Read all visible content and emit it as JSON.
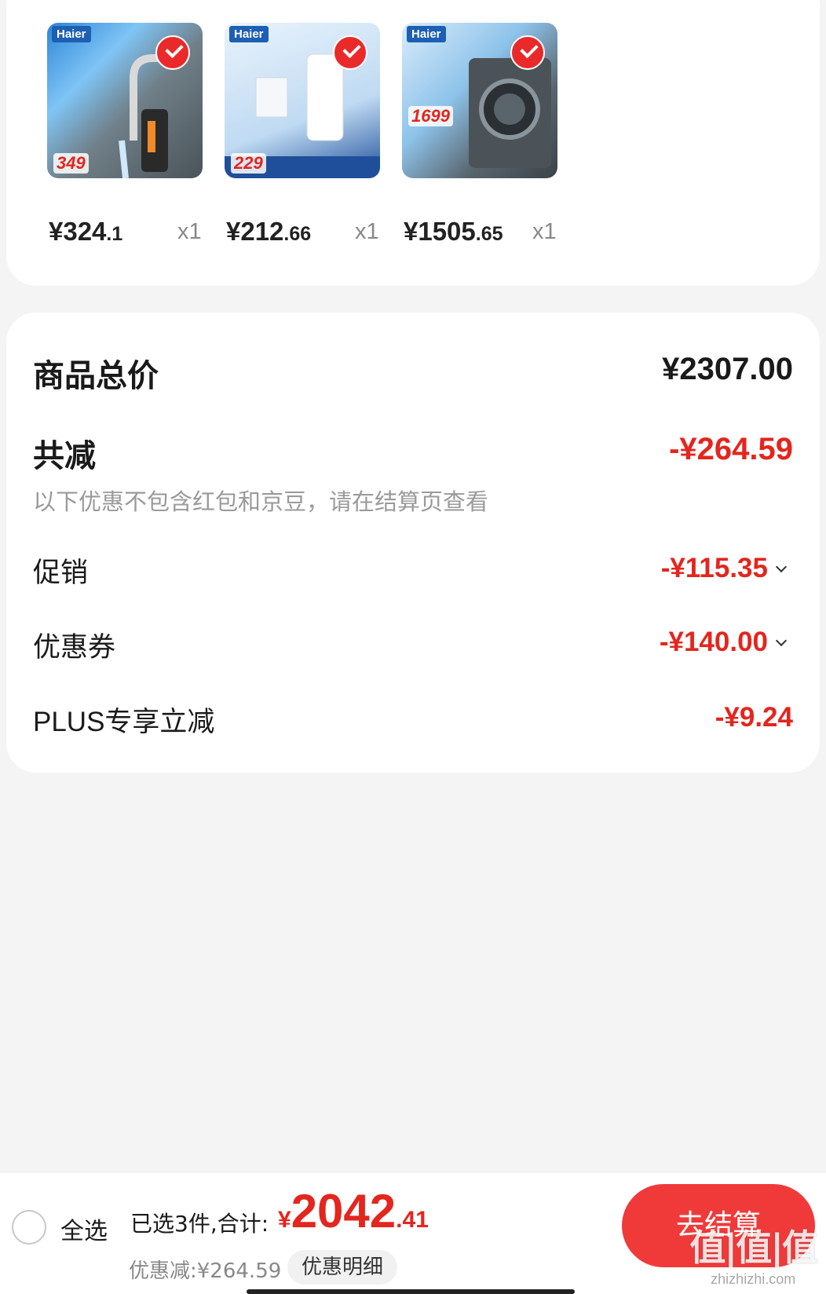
{
  "products": [
    {
      "brand": "Haier",
      "promo_price": "349",
      "price_int": "¥324",
      "price_dec": ".1",
      "qty": "x1",
      "thumb_bg": "#5b6b73",
      "selected": true
    },
    {
      "brand": "Haier",
      "promo_price": "229",
      "price_int": "¥212",
      "price_dec": ".66",
      "qty": "x1",
      "thumb_bg": "#bfdaf2",
      "selected": true
    },
    {
      "brand": "Haier",
      "promo_price": "1699",
      "price_int": "¥1505",
      "price_dec": ".65",
      "qty": "x1",
      "thumb_bg": "#6c7a86",
      "selected": true
    }
  ],
  "summary": {
    "total_label": "商品总价",
    "total_value": "¥2307.00",
    "cut_label": "共减",
    "cut_value": "-¥264.59",
    "note": "以下优惠不包含红包和京豆，请在结算页查看",
    "promotion_label": "促销",
    "promotion_value": "-¥115.35",
    "coupon_label": "优惠券",
    "coupon_value": "-¥140.00",
    "plus_label": "PLUS专享立减",
    "plus_value": "-¥9.24"
  },
  "bottom_bar": {
    "select_all": "全选",
    "selected_text": "已选3件,合计:",
    "total_symbol": "¥",
    "total_int": "2042",
    "total_dec": ".41",
    "discount_text": "优惠减:¥264.59",
    "detail_button": "优惠明细",
    "checkout_button": "去结算"
  },
  "watermark": {
    "mark": "值|值|值",
    "site": "zhizhizhi.com"
  },
  "colors": {
    "accent_red": "#e3261e",
    "checkout_red": "#f03a3a",
    "page_bg": "#f4f4f4"
  }
}
